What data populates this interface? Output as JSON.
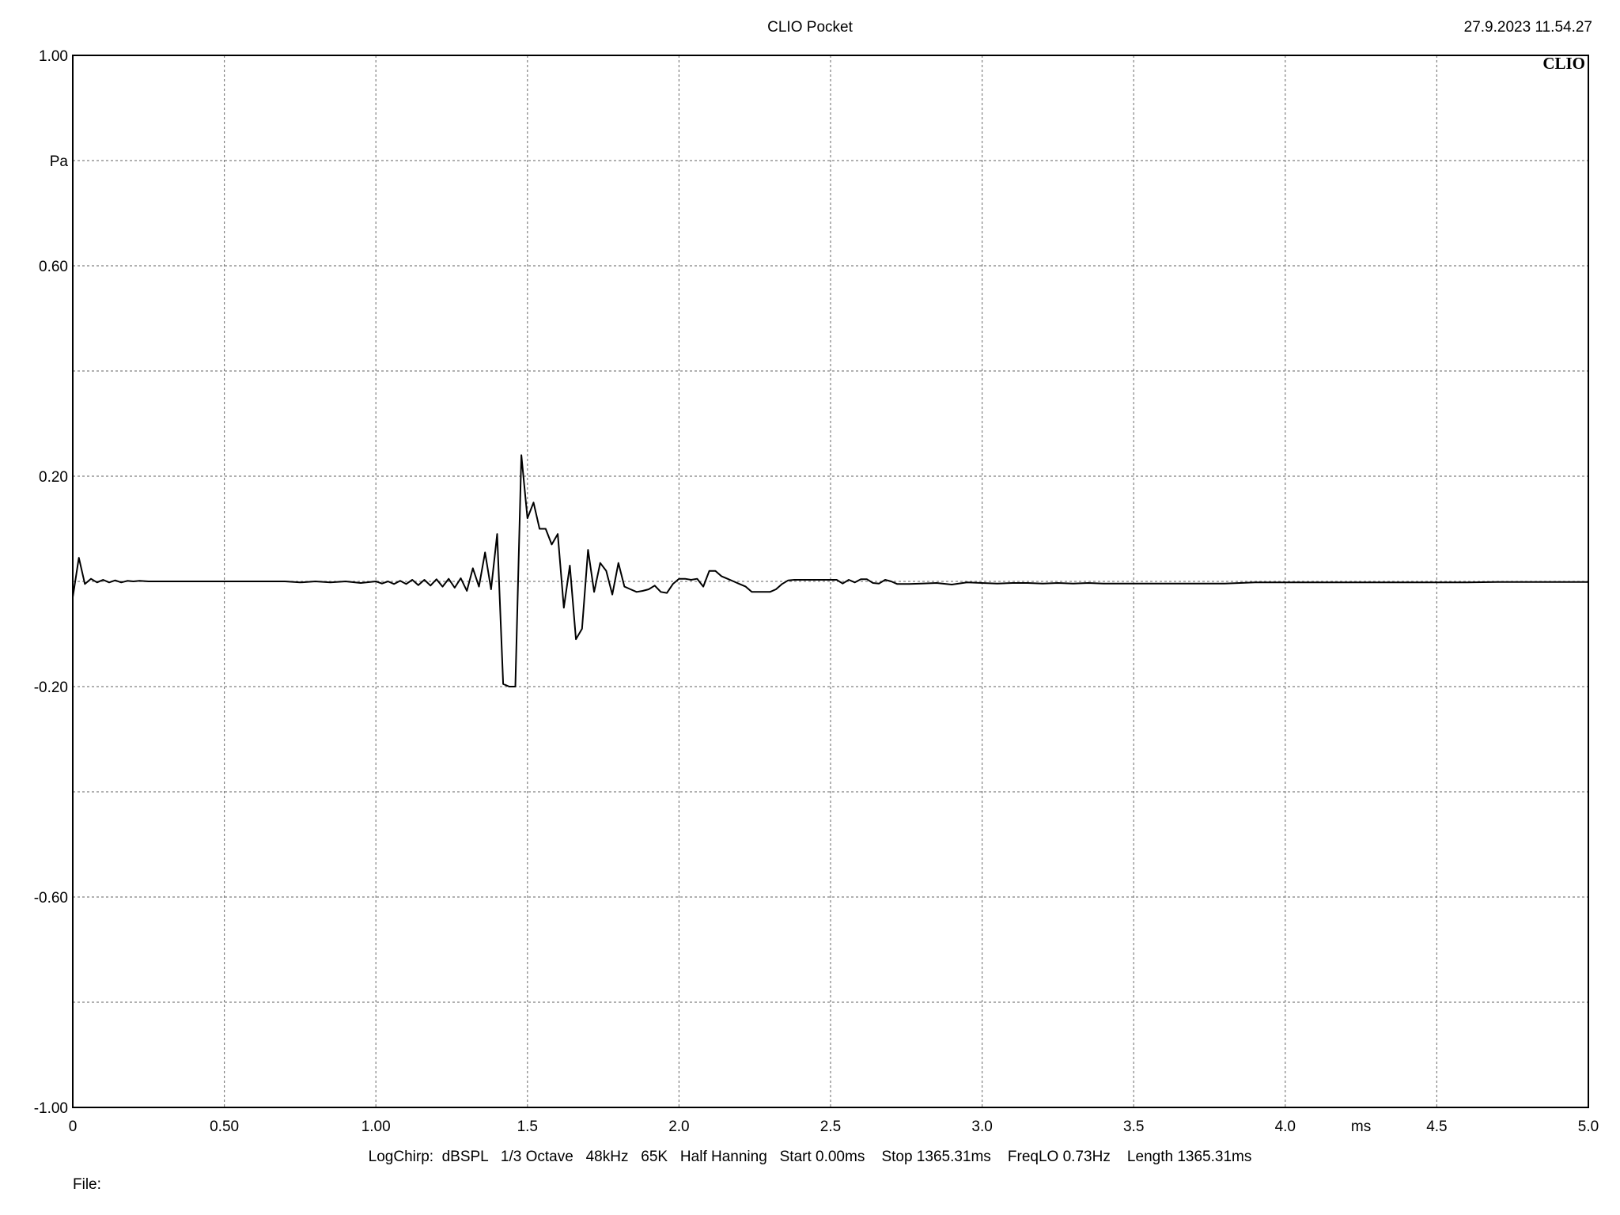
{
  "header": {
    "title": "CLIO Pocket",
    "timestamp": "27.9.2023 11.54.27",
    "logo": "CLIO"
  },
  "footer": {
    "settings": "LogChirp:  dBSPL   1/3 Octave   48kHz   65K   Half Hanning   Start 0.00ms    Stop 1365.31ms    FreqLO 0.73Hz    Length 1365.31ms",
    "file_label": "File:"
  },
  "colors": {
    "background": "#ffffff",
    "trace": "#000000",
    "grid": "#808080",
    "frame": "#000000"
  },
  "chart_data": {
    "type": "line",
    "title": "CLIO Pocket",
    "xlabel": "ms",
    "ylabel": "Pa",
    "xlim": [
      0,
      5.0
    ],
    "ylim": [
      -1.0,
      1.0
    ],
    "grid": true,
    "x_ticks": [
      {
        "value": 0,
        "label": "0"
      },
      {
        "value": 0.5,
        "label": "0.50"
      },
      {
        "value": 1.0,
        "label": "1.00"
      },
      {
        "value": 1.5,
        "label": "1.5"
      },
      {
        "value": 2.0,
        "label": "2.0"
      },
      {
        "value": 2.5,
        "label": "2.5"
      },
      {
        "value": 3.0,
        "label": "3.0"
      },
      {
        "value": 3.5,
        "label": "3.5"
      },
      {
        "value": 4.0,
        "label": "4.0"
      },
      {
        "value": 4.5,
        "label": "4.5"
      },
      {
        "value": 5.0,
        "label": "5.0"
      }
    ],
    "x_unit_label": {
      "value": 4.25,
      "label": "ms"
    },
    "y_ticks": [
      {
        "value": 1.0,
        "label": "1.00"
      },
      {
        "value": 0.8,
        "label": "Pa"
      },
      {
        "value": 0.6,
        "label": "0.60"
      },
      {
        "value": 0.4,
        "label": ""
      },
      {
        "value": 0.2,
        "label": "0.20"
      },
      {
        "value": 0.0,
        "label": ""
      },
      {
        "value": -0.2,
        "label": "-0.20"
      },
      {
        "value": -0.4,
        "label": ""
      },
      {
        "value": -0.6,
        "label": "-0.60"
      },
      {
        "value": -0.8,
        "label": ""
      },
      {
        "value": -1.0,
        "label": "-1.00"
      }
    ],
    "series": [
      {
        "x": [
          0,
          0.02,
          0.04,
          0.06,
          0.08,
          0.1,
          0.12,
          0.14,
          0.16,
          0.18,
          0.2,
          0.22,
          0.25,
          0.3,
          0.4,
          0.5,
          0.6,
          0.7,
          0.75,
          0.8,
          0.85,
          0.9,
          0.95,
          1.0,
          1.02,
          1.04,
          1.06,
          1.08,
          1.1,
          1.12,
          1.14,
          1.16,
          1.18,
          1.2,
          1.22,
          1.24,
          1.26,
          1.28,
          1.3,
          1.32,
          1.34,
          1.36,
          1.38,
          1.4,
          1.42,
          1.44,
          1.46,
          1.48,
          1.5,
          1.52,
          1.54,
          1.56,
          1.58,
          1.6,
          1.62,
          1.64,
          1.66,
          1.68,
          1.7,
          1.72,
          1.74,
          1.76,
          1.78,
          1.8,
          1.82,
          1.84,
          1.86,
          1.88,
          1.9,
          1.92,
          1.94,
          1.96,
          1.98,
          2.0,
          2.02,
          2.04,
          2.06,
          2.08,
          2.1,
          2.12,
          2.14,
          2.16,
          2.18,
          2.2,
          2.22,
          2.24,
          2.26,
          2.28,
          2.3,
          2.32,
          2.34,
          2.36,
          2.38,
          2.4,
          2.42,
          2.44,
          2.46,
          2.48,
          2.5,
          2.52,
          2.54,
          2.56,
          2.58,
          2.6,
          2.62,
          2.64,
          2.66,
          2.68,
          2.7,
          2.72,
          2.76,
          2.8,
          2.85,
          2.9,
          2.95,
          3.0,
          3.05,
          3.1,
          3.15,
          3.2,
          3.25,
          3.3,
          3.35,
          3.4,
          3.5,
          3.6,
          3.7,
          3.8,
          3.9,
          4.0,
          4.1,
          4.2,
          4.3,
          4.4,
          4.5,
          4.6,
          4.7,
          4.8,
          4.9,
          5.0
        ],
        "y": [
          -0.03,
          0.045,
          -0.005,
          0.005,
          -0.002,
          0.003,
          -0.002,
          0.002,
          -0.002,
          0.001,
          0.0,
          0.001,
          0.0,
          0.0,
          0.0,
          0.0,
          0.0,
          0.0,
          -0.002,
          0.0,
          -0.002,
          0.0,
          -0.003,
          0.0,
          -0.004,
          0.0,
          -0.005,
          0.001,
          -0.005,
          0.003,
          -0.007,
          0.003,
          -0.008,
          0.004,
          -0.01,
          0.005,
          -0.012,
          0.006,
          -0.018,
          0.025,
          -0.01,
          0.055,
          -0.015,
          0.09,
          -0.195,
          -0.2,
          -0.2,
          0.24,
          0.12,
          0.15,
          0.1,
          0.1,
          0.07,
          0.09,
          -0.05,
          0.03,
          -0.11,
          -0.09,
          0.06,
          -0.02,
          0.035,
          0.02,
          -0.025,
          0.035,
          -0.01,
          -0.015,
          -0.02,
          -0.018,
          -0.015,
          -0.008,
          -0.02,
          -0.022,
          -0.005,
          0.005,
          0.005,
          0.003,
          0.005,
          -0.01,
          0.02,
          0.02,
          0.01,
          0.005,
          0.0,
          -0.005,
          -0.01,
          -0.02,
          -0.02,
          -0.02,
          -0.02,
          -0.015,
          -0.005,
          0.002,
          0.003,
          0.003,
          0.003,
          0.003,
          0.003,
          0.003,
          0.003,
          0.003,
          -0.004,
          0.003,
          -0.002,
          0.004,
          0.004,
          -0.003,
          -0.004,
          0.003,
          0.0,
          -0.005,
          -0.005,
          -0.004,
          -0.003,
          -0.006,
          -0.002,
          -0.003,
          -0.004,
          -0.003,
          -0.003,
          -0.004,
          -0.003,
          -0.004,
          -0.003,
          -0.004,
          -0.004,
          -0.004,
          -0.004,
          -0.004,
          -0.002,
          -0.002,
          -0.002,
          -0.002,
          -0.002,
          -0.002,
          -0.002,
          -0.002,
          -0.001,
          -0.001,
          -0.001,
          -0.001
        ]
      }
    ]
  }
}
